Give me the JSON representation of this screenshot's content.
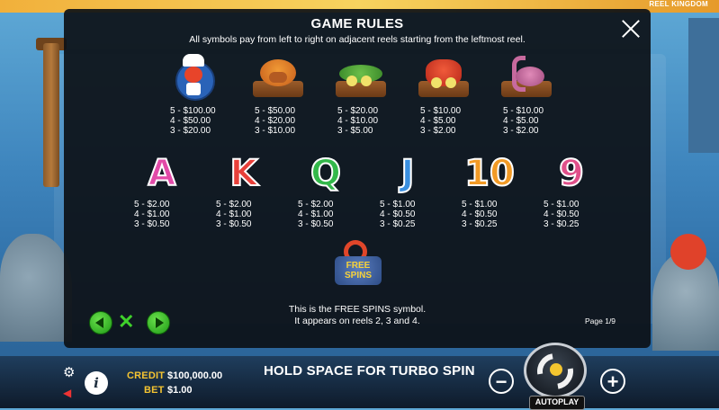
{
  "brand": "REEL KINGDOM",
  "modal": {
    "title": "GAME RULES",
    "subtitle": "All symbols pay from left to right on adjacent reels starting from the leftmost reel.",
    "high_symbols": [
      {
        "icon": "lobster-chef-icon",
        "pays": [
          "5 - $100.00",
          "4 - $50.00",
          "3 - $20.00"
        ]
      },
      {
        "icon": "crab-burger-icon",
        "pays": [
          "5 - $50.00",
          "4 - $20.00",
          "3 - $10.00"
        ]
      },
      {
        "icon": "fish-platter-icon",
        "pays": [
          "5 - $20.00",
          "4 - $10.00",
          "3 - $5.00"
        ]
      },
      {
        "icon": "shrimp-platter-icon",
        "pays": [
          "5 - $10.00",
          "4 - $5.00",
          "3 - $2.00"
        ]
      },
      {
        "icon": "octopus-platter-icon",
        "pays": [
          "5 - $10.00",
          "4 - $5.00",
          "3 - $2.00"
        ]
      }
    ],
    "low_symbols": [
      {
        "letter": "A",
        "color": "#e24aa8",
        "pays": [
          "5 - $2.00",
          "4 - $1.00",
          "3 - $0.50"
        ]
      },
      {
        "letter": "K",
        "color": "#e8403a",
        "pays": [
          "5 - $2.00",
          "4 - $1.00",
          "3 - $0.50"
        ]
      },
      {
        "letter": "Q",
        "color": "#33b84a",
        "pays": [
          "5 - $2.00",
          "4 - $1.00",
          "3 - $0.50"
        ]
      },
      {
        "letter": "J",
        "color": "#3a8fe0",
        "pays": [
          "5 - $1.00",
          "4 - $0.50",
          "3 - $0.25"
        ]
      },
      {
        "letter": "10",
        "color": "#f29a25",
        "pays": [
          "5 - $1.00",
          "4 - $0.50",
          "3 - $0.25"
        ]
      },
      {
        "letter": "9",
        "color": "#e0508a",
        "pays": [
          "5 - $1.00",
          "4 - $0.50",
          "3 - $0.25"
        ]
      }
    ],
    "free_spins": {
      "logo_text": "FREE SPINS",
      "line1": "This is the FREE SPINS symbol.",
      "line2": "It appears on reels 2, 3 and 4."
    },
    "page": "Page 1/9"
  },
  "bottom": {
    "credit_label": "CREDIT",
    "credit_value": "$100,000.00",
    "bet_label": "BET",
    "bet_value": "$1.00",
    "turbo_hint": "HOLD SPACE FOR TURBO SPIN",
    "minus": "−",
    "plus": "+",
    "autoplay": "AUTOPLAY"
  }
}
